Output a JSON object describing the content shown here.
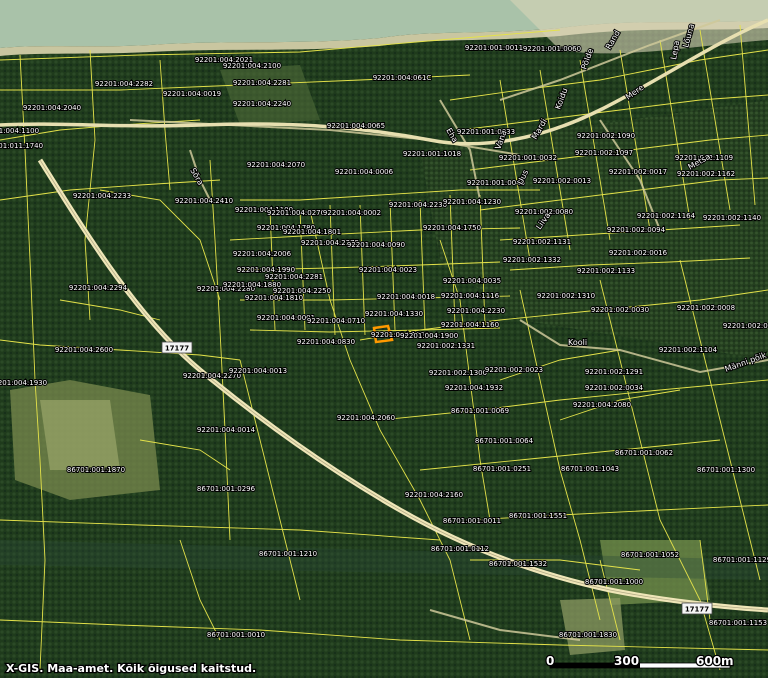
{
  "copyright": "X-GIS. Maa-amet. Kõik õigused kaitstud.",
  "scale_bar": {
    "labels": [
      "0",
      "300",
      "600m"
    ]
  },
  "road_number": "17177",
  "street_names": [
    "Mere",
    "Mardi",
    "Põlde",
    "Rand",
    "Lõuna",
    "Metsa",
    "Liiva",
    "Eha",
    "Uus",
    "Vana",
    "Koidu",
    "Lepa",
    "Männi põik",
    "Sõra",
    "Kooli"
  ],
  "parcels": [
    "92201:004:2021",
    "92201:004:2282",
    "92201:004:2100",
    "92201:004:2281",
    "92201:004:0019",
    "92201:004:061C",
    "92201:004:2240",
    "92201:004:2040",
    "92201:004:1100",
    "92201:011:1740",
    "92201:004:2233",
    "92201:004:2410",
    "92201:004:0065",
    "92201:004:0006",
    "92201:004:2070",
    "92201:001:1018",
    "92201:001:0011",
    "92201:001:0060",
    "92201:001:0033",
    "92201:002:1090",
    "92201:001:0032",
    "92201:002:0013",
    "92201:002:1097",
    "92201:002:0017",
    "92201:002:1162",
    "92201:002:1109",
    "92201:001:0045",
    "92201:002:0080",
    "92201:002:1164",
    "92201:002:1140",
    "92201:004:1100",
    "92201:004:0270",
    "92201:004:0002",
    "92201:004:2230",
    "92201:004:1780",
    "92201:004:1801",
    "92201:004:1230",
    "92201:004:1750",
    "92201:004:2275",
    "92201:004:0090",
    "92201:002:1131",
    "92201:002:0094",
    "92201:002:0016",
    "92201:004:2006",
    "92201:004:1990",
    "92201:004:2281",
    "92201:004:0023",
    "92201:004:0035",
    "92201:002:1332",
    "92201:002:1133",
    "92201:004:2294",
    "92201:004:2280",
    "92201:004:1880",
    "92201:004:2250",
    "92201:004:0018",
    "92201:004:1116",
    "92201:002:1310",
    "92201:002:0030",
    "92201:004:1810",
    "92201:004:2230",
    "92201:004:1330",
    "92201:004:0001",
    "92201:004:0710",
    "92201:004:1160",
    "92201:002:0008",
    "92201:002:0062",
    "92201:004:1800",
    "92201:002:1331",
    "92201:002:1104",
    "92201:004:0830",
    "92201:004:2600",
    "92201:004:2270",
    "92201:004:0013",
    "92201:002:1291",
    "92201:002:1300",
    "92201:004:1930",
    "92201:004:1932",
    "92201:002:0023",
    "92201:002:0034",
    "92201:004:2080",
    "86701:001:0069",
    "92201:004:0014",
    "86701:001:0064",
    "86701:001:0062",
    "86701:001:1870",
    "86701:001:1043",
    "86701:001:0251",
    "92201:004:2060",
    "92201:004:2160",
    "86701:001:1300",
    "86701:001:0296",
    "86701:001:1551",
    "86701:001:0011",
    "86701:001:0112",
    "86701:001:1210",
    "86701:001:1532",
    "86701:001:1052",
    "86701:001:1129",
    "86701:001:1000",
    "86701:001:1830",
    "86701:001:0010",
    "86701:001:1153"
  ],
  "selected_parcel": "92201:004:1900",
  "colors": {
    "parcel_line": "#e4e24a",
    "highway": "#e6dcaa",
    "selected": "#ff9900",
    "sea": "#9fb8a0",
    "forest": "#1e3a1b"
  }
}
